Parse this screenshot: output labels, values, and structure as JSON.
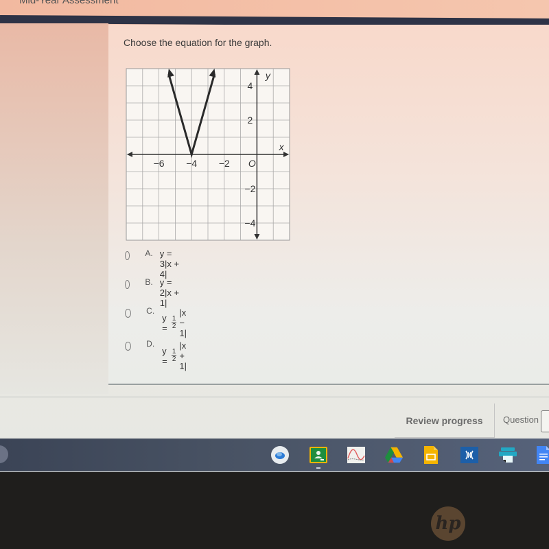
{
  "app": {
    "title": "Mid-Year Assessment"
  },
  "question": {
    "prompt": "Choose the equation for the graph.",
    "graph": {
      "x_axis_label": "x",
      "y_axis_label": "y",
      "origin_label": "O",
      "x_tick_labels": [
        "−6",
        "−4",
        "−2"
      ],
      "y_tick_labels": [
        "4",
        "2",
        "−2",
        "−4"
      ],
      "x_range": [
        -8,
        2
      ],
      "y_range": [
        -5,
        5
      ],
      "vertex": [
        -4,
        0
      ],
      "left_ray_end": [
        -5.4,
        5
      ],
      "right_ray_end": [
        -2.6,
        5
      ]
    },
    "choices": [
      {
        "letter": "A.",
        "prefix": "y = 3|x + 4|"
      },
      {
        "letter": "B.",
        "prefix": "y = 2|x + 1|"
      },
      {
        "letter": "C.",
        "prefix": "y = ",
        "frac_num": "1",
        "frac_den": "2",
        "suffix": "|x − 1|"
      },
      {
        "letter": "D.",
        "prefix": "y = ",
        "frac_num": "1",
        "frac_den": "2",
        "suffix": "|x + 1|"
      }
    ]
  },
  "footer": {
    "review_label": "Review progress",
    "question_label": "Question",
    "question_value": ""
  },
  "taskbar": {
    "apps": [
      {
        "name": "chromebook-app-icon",
        "color": "#2b7bd6"
      },
      {
        "name": "google-classroom-icon",
        "color": "#1e8e3e"
      },
      {
        "name": "graphing-app-icon",
        "color": "#e06060"
      },
      {
        "name": "google-drive-icon",
        "color": "#f4b400"
      },
      {
        "name": "google-slides-icon",
        "color": "#f4b400"
      },
      {
        "name": "kami-app-icon",
        "color": "#1d5fa8"
      },
      {
        "name": "printer-app-icon",
        "color": "#22a8c4"
      },
      {
        "name": "google-docs-icon",
        "color": "#4285f4"
      }
    ]
  },
  "device": {
    "logo": "hp"
  }
}
